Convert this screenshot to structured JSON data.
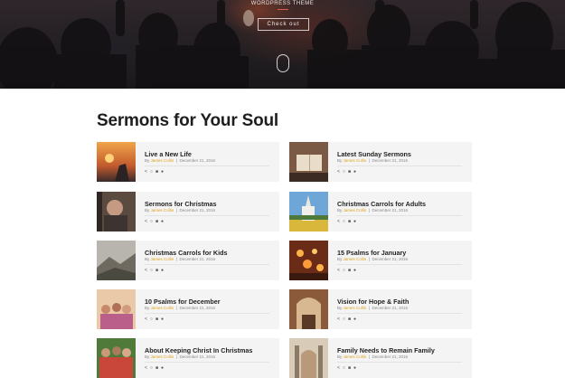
{
  "hero": {
    "tagline": "WORDPRESS THEME",
    "cta_label": "Check out"
  },
  "section": {
    "title": "Sermons for Your Soul"
  },
  "sermons": [
    {
      "title": "Live a New Life",
      "by": "By",
      "author": "James Collin",
      "sep": "|",
      "date": "December 21, 2016",
      "thumb": "sunset"
    },
    {
      "title": "Latest Sunday Sermons",
      "by": "By",
      "author": "James Collin",
      "sep": "|",
      "date": "December 21, 2016",
      "thumb": "bible"
    },
    {
      "title": "Sermons for Christmas",
      "by": "By",
      "author": "James Collin",
      "sep": "|",
      "date": "December 21, 2016",
      "thumb": "praying"
    },
    {
      "title": "Christmas Carrols for Adults",
      "by": "By",
      "author": "James Collin",
      "sep": "|",
      "date": "December 21, 2016",
      "thumb": "church"
    },
    {
      "title": "Christmas Carrols for Kids",
      "by": "By",
      "author": "James Collin",
      "sep": "|",
      "date": "December 21, 2016",
      "thumb": "landscape"
    },
    {
      "title": "15 Psalms for January",
      "by": "By",
      "author": "James Collin",
      "sep": "|",
      "date": "December 21, 2016",
      "thumb": "candles"
    },
    {
      "title": "10 Psalms for December",
      "by": "By",
      "author": "James Collin",
      "sep": "|",
      "date": "December 21, 2016",
      "thumb": "crowd"
    },
    {
      "title": "Vision for Hope & Faith",
      "by": "By",
      "author": "James Collin",
      "sep": "|",
      "date": "December 21, 2016",
      "thumb": "interior"
    },
    {
      "title": "About Keeping Christ In Christmas",
      "by": "By",
      "author": "James Collin",
      "sep": "|",
      "date": "December 21, 2016",
      "thumb": "group"
    },
    {
      "title": "Family Needs to Remain Family",
      "by": "By",
      "author": "James Collin",
      "sep": "|",
      "date": "December 21, 2016",
      "thumb": "cathedral"
    }
  ],
  "card_icons": [
    "share-icon",
    "comment-icon",
    "video-icon",
    "audio-icon"
  ],
  "colors": {
    "accent_author": "#e0a21f",
    "hero_underline": "#e05a47",
    "card_bg": "#f4f4f4"
  }
}
